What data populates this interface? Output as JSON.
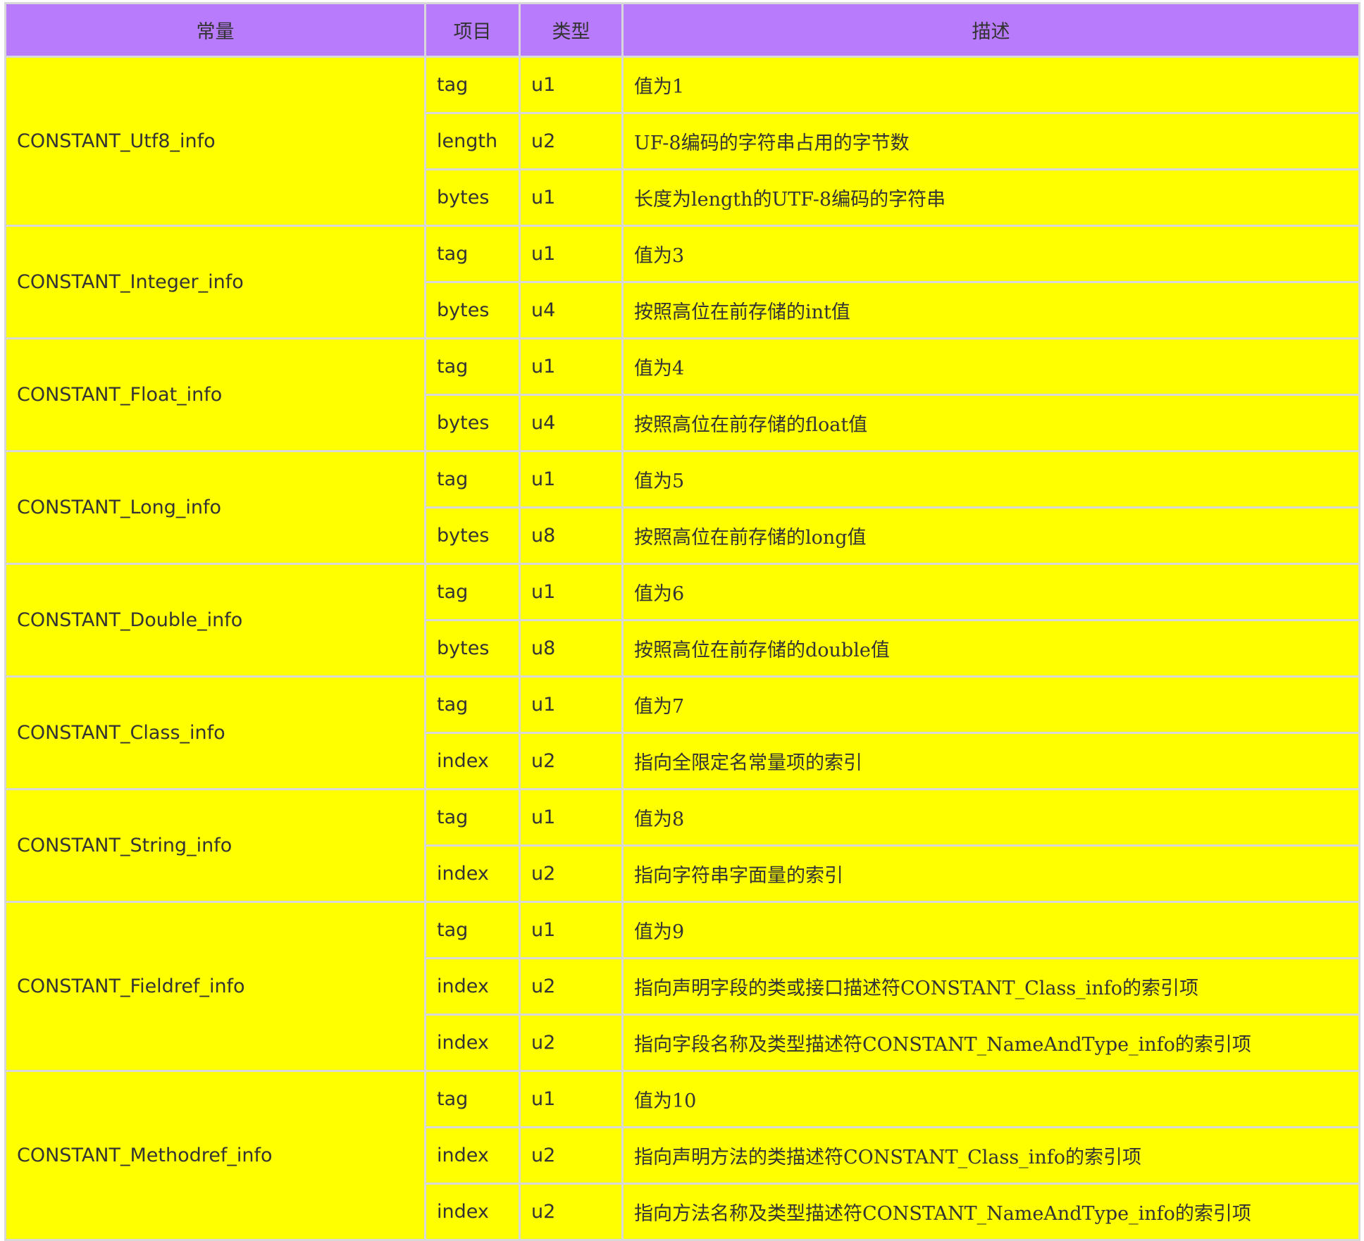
{
  "headers": [
    "常量",
    "项目",
    "类型",
    "描述"
  ],
  "groups": [
    {
      "constant": "CONSTANT_Utf8_info",
      "rows": [
        {
          "item": "tag",
          "type": "u1",
          "desc": "值为1"
        },
        {
          "item": "length",
          "type": "u2",
          "desc": "UF-8编码的字符串占用的字节数"
        },
        {
          "item": "bytes",
          "type": "u1",
          "desc": "长度为length的UTF-8编码的字符串"
        }
      ]
    },
    {
      "constant": "CONSTANT_Integer_info",
      "rows": [
        {
          "item": "tag",
          "type": "u1",
          "desc": "值为3"
        },
        {
          "item": "bytes",
          "type": "u4",
          "desc": "按照高位在前存储的int值"
        }
      ]
    },
    {
      "constant": "CONSTANT_Float_info",
      "rows": [
        {
          "item": "tag",
          "type": "u1",
          "desc": "值为4"
        },
        {
          "item": "bytes",
          "type": "u4",
          "desc": "按照高位在前存储的float值"
        }
      ]
    },
    {
      "constant": "CONSTANT_Long_info",
      "rows": [
        {
          "item": "tag",
          "type": "u1",
          "desc": "值为5"
        },
        {
          "item": "bytes",
          "type": "u8",
          "desc": "按照高位在前存储的long值"
        }
      ]
    },
    {
      "constant": "CONSTANT_Double_info",
      "rows": [
        {
          "item": "tag",
          "type": "u1",
          "desc": "值为6"
        },
        {
          "item": "bytes",
          "type": "u8",
          "desc": "按照高位在前存储的double值"
        }
      ]
    },
    {
      "constant": "CONSTANT_Class_info",
      "rows": [
        {
          "item": "tag",
          "type": "u1",
          "desc": "值为7"
        },
        {
          "item": "index",
          "type": "u2",
          "desc": "指向全限定名常量项的索引"
        }
      ]
    },
    {
      "constant": "CONSTANT_String_info",
      "rows": [
        {
          "item": "tag",
          "type": "u1",
          "desc": "值为8"
        },
        {
          "item": "index",
          "type": "u2",
          "desc": "指向字符串字面量的索引"
        }
      ]
    },
    {
      "constant": "CONSTANT_Fieldref_info",
      "rows": [
        {
          "item": "tag",
          "type": "u1",
          "desc": "值为9"
        },
        {
          "item": "index",
          "type": "u2",
          "desc": "指向声明字段的类或接口描述符CONSTANT_Class_info的索引项"
        },
        {
          "item": "index",
          "type": "u2",
          "desc": "指向字段名称及类型描述符CONSTANT_NameAndType_info的索引项"
        }
      ]
    },
    {
      "constant": "CONSTANT_Methodref_info",
      "rows": [
        {
          "item": "tag",
          "type": "u1",
          "desc": "值为10"
        },
        {
          "item": "index",
          "type": "u2",
          "desc": "指向声明方法的类描述符CONSTANT_Class_info的索引项"
        },
        {
          "item": "index",
          "type": "u2",
          "desc": "指向方法名称及类型描述符CONSTANT_NameAndType_info的索引项"
        }
      ]
    }
  ]
}
